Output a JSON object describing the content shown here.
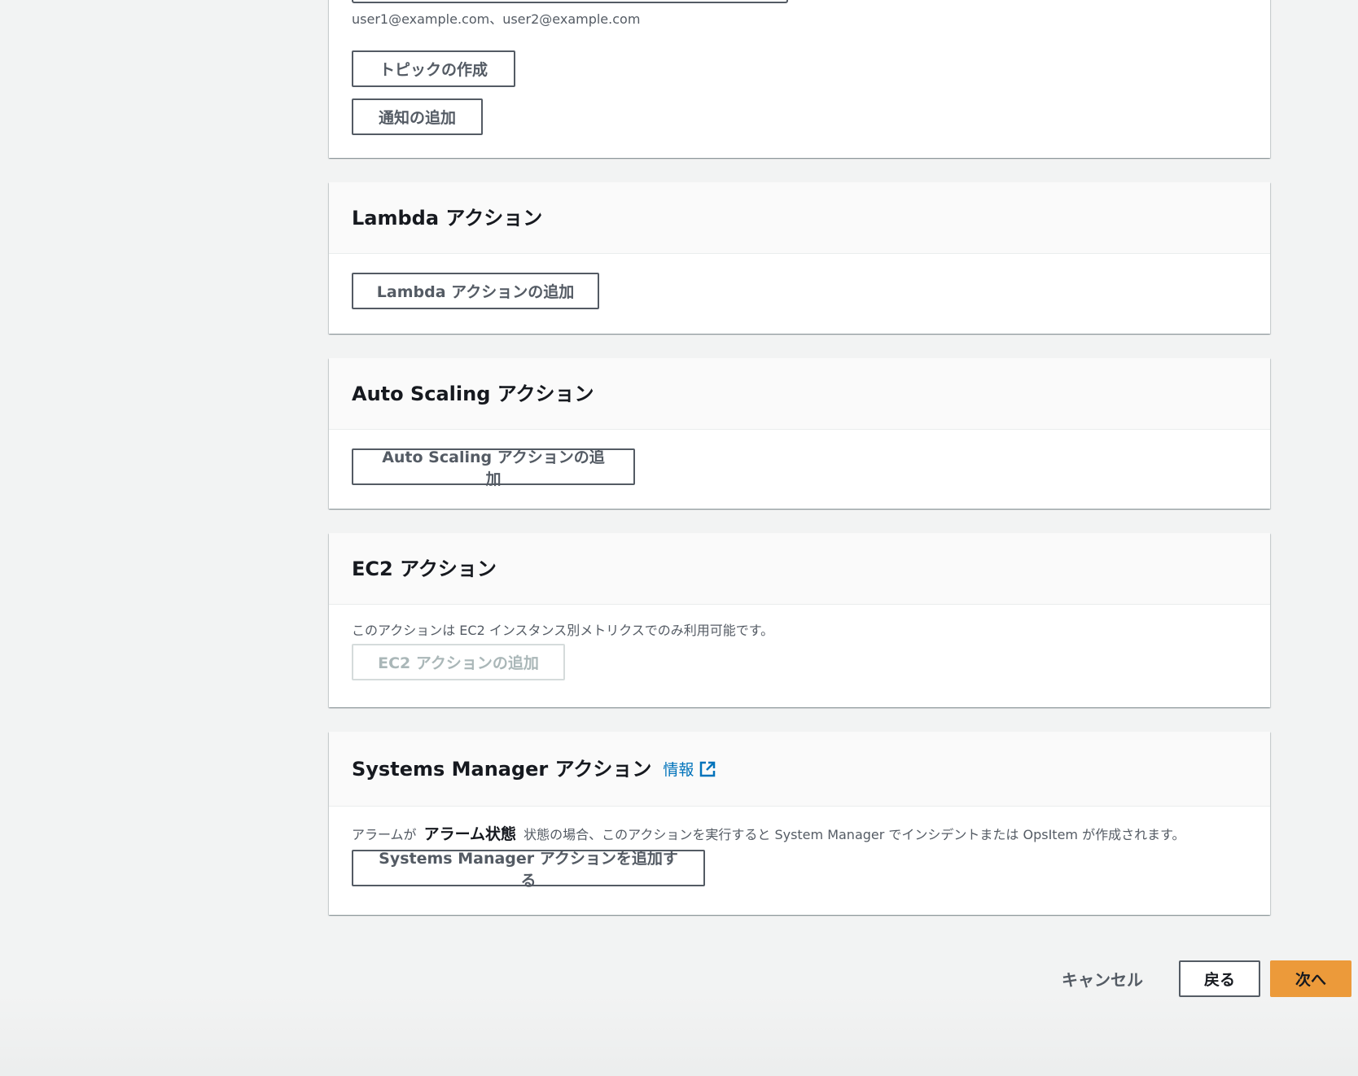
{
  "sns_panel": {
    "email_hint": "user1@example.com、user2@example.com",
    "create_topic_button": "トピックの作成",
    "add_notification_button": "通知の追加"
  },
  "lambda_panel": {
    "title": "Lambda アクション",
    "add_button": "Lambda アクションの追加"
  },
  "autoscaling_panel": {
    "title": "Auto Scaling アクション",
    "add_button": "Auto Scaling アクションの追加"
  },
  "ec2_panel": {
    "title": "EC2 アクション",
    "description": "このアクションは EC2 インスタンス別メトリクスでのみ利用可能です。",
    "add_button": "EC2 アクションの追加"
  },
  "ssm_panel": {
    "title": "Systems Manager アクション",
    "info_link": "情報",
    "description_prefix": "アラームが",
    "description_state": "アラーム状態",
    "description_suffix": "状態の場合、このアクションを実行すると System Manager でインシデントまたは OpsItem が作成されます。",
    "add_button": "Systems Manager アクションを追加する"
  },
  "footer": {
    "cancel": "キャンセル",
    "back": "戻る",
    "next": "次へ"
  },
  "colors": {
    "page_background": "#f2f3f3",
    "link_blue": "#0073bb",
    "primary_orange": "#ec9a3a",
    "button_border": "#545b64"
  },
  "icons": {
    "external_link": "external-link-icon"
  }
}
